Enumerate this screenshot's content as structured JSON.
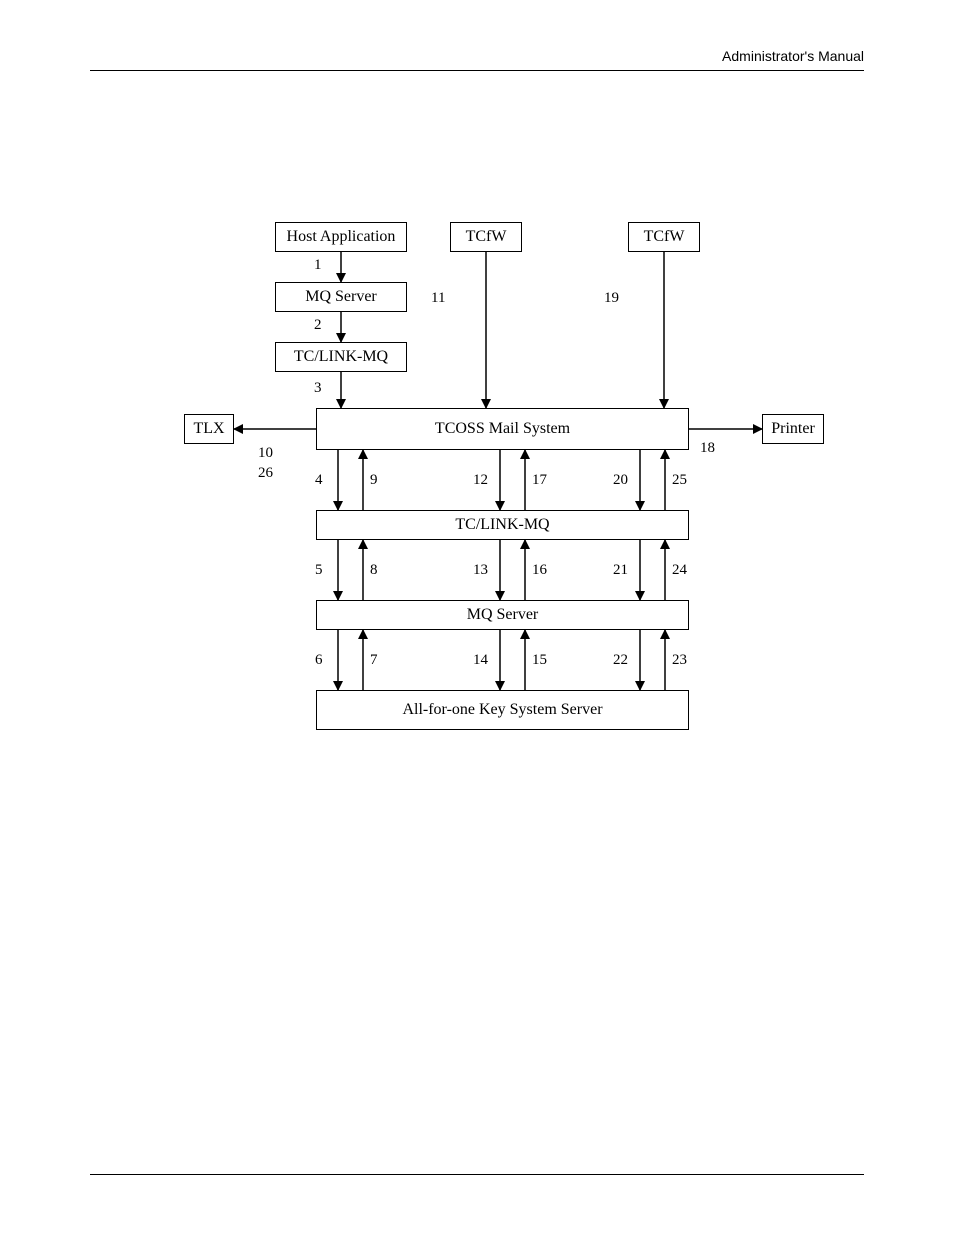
{
  "header": {
    "title": "Administrator's Manual"
  },
  "boxes": {
    "host_app": "Host Application",
    "tcfw1": "TCfW",
    "tcfw2": "TCfW",
    "mq_server_top": "MQ Server",
    "tclink_mq_top": "TC/LINK-MQ",
    "tlx": "TLX",
    "printer": "Printer",
    "tcoss": "TCOSS Mail System",
    "tclink_mq_mid": "TC/LINK-MQ",
    "mq_server_mid": "MQ Server",
    "all_for_one": "All-for-one Key System Server"
  },
  "numbers": {
    "n1": "1",
    "n2": "2",
    "n3": "3",
    "n4": "4",
    "n5": "5",
    "n6": "6",
    "n7": "7",
    "n8": "8",
    "n9": "9",
    "n10": "10",
    "n11": "11",
    "n12": "12",
    "n13": "13",
    "n14": "14",
    "n15": "15",
    "n16": "16",
    "n17": "17",
    "n18": "18",
    "n19": "19",
    "n20": "20",
    "n21": "21",
    "n22": "22",
    "n23": "23",
    "n24": "24",
    "n25": "25",
    "n26": "26"
  }
}
